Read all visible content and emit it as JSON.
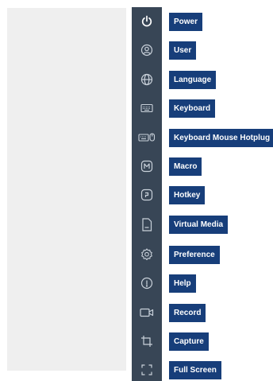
{
  "menu": {
    "items": [
      {
        "label": "Power",
        "icon": "power-icon"
      },
      {
        "label": "User",
        "icon": "user-icon"
      },
      {
        "label": "Language",
        "icon": "globe-icon"
      },
      {
        "label": "Keyboard",
        "icon": "keyboard-icon"
      },
      {
        "label": "Keyboard Mouse Hotplug",
        "icon": "keyboard-mouse-icon"
      },
      {
        "label": "Macro",
        "icon": "macro-icon"
      },
      {
        "label": "Hotkey",
        "icon": "hotkey-icon"
      },
      {
        "label": "Virtual Media",
        "icon": "file-icon"
      },
      {
        "label": "Preference",
        "icon": "gear-icon"
      },
      {
        "label": "Help",
        "icon": "help-icon"
      },
      {
        "label": "Record",
        "icon": "video-camera-icon"
      },
      {
        "label": "Capture",
        "icon": "crop-icon"
      },
      {
        "label": "Full Screen",
        "icon": "fullscreen-icon"
      }
    ]
  },
  "colors": {
    "sidebar_background": "#384656",
    "label_background": "#173e7a",
    "label_text": "#ffffff",
    "icon": "#c9d1da",
    "viewer_background": "#efefef"
  }
}
